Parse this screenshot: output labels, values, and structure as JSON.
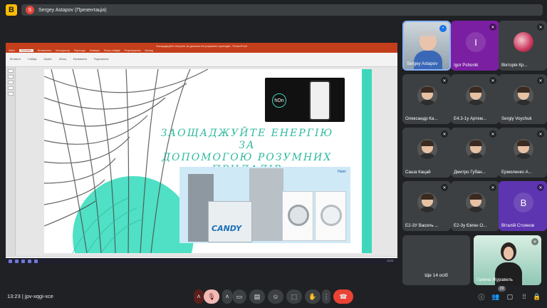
{
  "app": {
    "icon_label": "B"
  },
  "presenter": {
    "initial": "S",
    "label": "Sergey Astapov (Презентація)"
  },
  "ppt": {
    "window_title": "Заощаджуйте енергію за допомогою розумних приладів - PowerPoint",
    "tabs": [
      "Файл",
      "Основне",
      "Вставлення",
      "Конструктор",
      "Переходи",
      "Анімація",
      "Показ слайдів",
      "Рецензування",
      "Вигляд"
    ],
    "active_tab_index": 1,
    "ribbon_groups": [
      "Вставити",
      "Слайди",
      "Шрифт",
      "Абзац",
      "Малювання",
      "Редагування"
    ],
    "taskbar_time": "13:23"
  },
  "slide": {
    "title_line1": "ЗАОЩАДЖУЙТЕ ЕНЕРГІЮ ЗА",
    "title_line2": "ДОПОМОГОЮ РОЗУМНИХ",
    "title_line3": "ПРИЛАДІВ",
    "hon_logo": "hOn",
    "candy_logo": "CANDY",
    "haier_logo": "Haier",
    "accent_color": "#3ed7bc"
  },
  "participants": [
    {
      "name": "Sergey Astapov",
      "type": "video",
      "muted": false,
      "speaking": true
    },
    {
      "name": "Igor Pshonik",
      "type": "letter",
      "letter": "I",
      "color": "#7b1fa2",
      "muted": true
    },
    {
      "name": "Вікторія Кр...",
      "type": "flower",
      "muted": true
    },
    {
      "name": "Олександр Ка...",
      "type": "photo",
      "muted": true
    },
    {
      "name": "Е4.3-1у Артем...",
      "type": "photo",
      "muted": true
    },
    {
      "name": "Sergiy Voychuk",
      "type": "photo",
      "muted": true
    },
    {
      "name": "Саша Кацай",
      "type": "photo",
      "muted": true
    },
    {
      "name": "Дмитро Губан...",
      "type": "photo",
      "muted": true
    },
    {
      "name": "Ермоленко А...",
      "type": "photo",
      "muted": true
    },
    {
      "name": "Е2-3У Василь ...",
      "type": "photo",
      "muted": true
    },
    {
      "name": "Е2-3у Євген О...",
      "type": "photo",
      "muted": true
    },
    {
      "name": "Віталій Стоянов",
      "type": "letter",
      "letter": "В",
      "color": "#5e35b1",
      "muted": true
    }
  ],
  "others_tile": {
    "label": "Ще 14 осіб"
  },
  "self_tile": {
    "name": "Галина Журавель",
    "muted": true
  },
  "bottom": {
    "time": "13:23",
    "meeting_code": "jpv-xqgi-xce",
    "participant_count": "29",
    "colors": {
      "end_call": "#ea4335",
      "mic_off": "#f2b8b5"
    }
  }
}
